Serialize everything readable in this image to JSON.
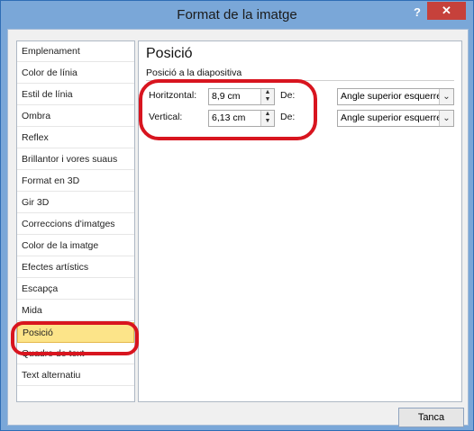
{
  "window": {
    "title": "Format de la imatge",
    "help": "?",
    "close": "✕"
  },
  "nav": {
    "items": [
      {
        "label": "Emplenament"
      },
      {
        "label": "Color de línia"
      },
      {
        "label": "Estil de línia"
      },
      {
        "label": "Ombra"
      },
      {
        "label": "Reflex"
      },
      {
        "label": "Brillantor i vores suaus"
      },
      {
        "label": "Format en 3D"
      },
      {
        "label": "Gir 3D"
      },
      {
        "label": "Correccions d'imatges"
      },
      {
        "label": "Color de la imatge"
      },
      {
        "label": "Efectes artístics"
      },
      {
        "label": "Escapça"
      },
      {
        "label": "Mida"
      },
      {
        "label": "Posició"
      },
      {
        "label": "Quadre de text"
      },
      {
        "label": "Text alternatiu"
      }
    ],
    "selected": "Posició"
  },
  "panel": {
    "title": "Posició",
    "section": "Posició a la diapositiva",
    "horizontal": {
      "label": "Horitzontal:",
      "value": "8,9 cm",
      "from_label": "De:",
      "from_value": "Angle superior esquerre"
    },
    "vertical": {
      "label": "Vertical:",
      "value": "6,13 cm",
      "from_label": "De:",
      "from_value": "Angle superior esquerre"
    }
  },
  "buttons": {
    "close": "Tanca"
  },
  "colors": {
    "selected_bg": "#fce489",
    "annotation": "#d8151f",
    "titlebar": "#7aa7d8"
  }
}
